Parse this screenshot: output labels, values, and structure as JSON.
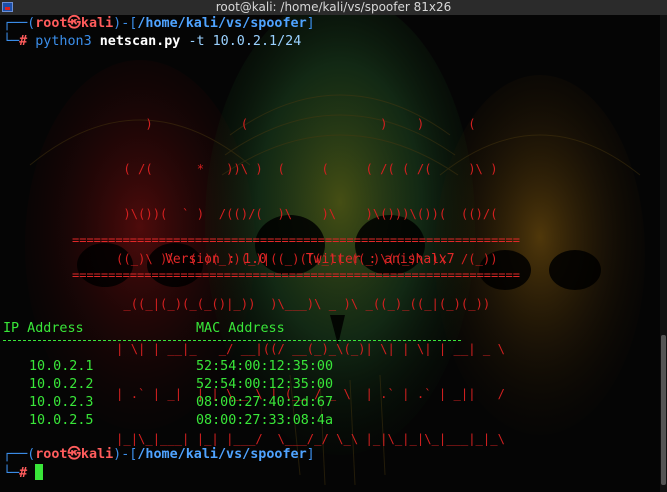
{
  "window": {
    "title": "root@kali: /home/kali/vs/spoofer 81x26"
  },
  "colors": {
    "prompt_blue": "#3b8eea",
    "user_red": "#ff5c5c",
    "banner_red": "#d42020",
    "output_green": "#39e639",
    "background": "#050505"
  },
  "prompt1": {
    "corner_top": "┌──(",
    "user": "root㉿kali",
    "mid": ")-[",
    "path": "/home/kali/vs/spoofer",
    "close": "]",
    "corner_bottom": "└─",
    "hash": "#",
    "command": "python3",
    "script": "netscan.py",
    "args": "-t 10.0.2.1/24"
  },
  "banner": {
    "ascii": [
      "          )            (                  )    )      (     ",
      "       ( /(      *   ))\\ )  (     (     ( /( ( /(     )\\ )  ",
      "       )\\())(  ` )  /(()/(  )\\    )\\    )\\()))\\())(  (()/(  ",
      "      ((_)\\ )\\  ( )(_))(_)|((_)(((_)( ((_)\\((_)\\ )\\  /(_)) ",
      "       _((_|(_)(_(_()|_))  )\\___)\\ _ )\\ _((_)_((_|(_)(_))   ",
      "      | \\| | __|_   _/ __|((/ __(_)_\\(_)| \\| | \\| | __| _ \\  ",
      "      | .` | _|  | | \\__ \\ | (__ / _ \\  | .` | .` | _||   /  ",
      "      |_|\\_|___| |_| |___/  \\___/_/ \\_\\ |_|\\_|_|\\_|___|_|_\\  "
    ],
    "separator": "==============================================================",
    "version_label": "Version :",
    "version_value": "1.0",
    "twitter_label": "Twitter :",
    "twitter_value": "anishalx7"
  },
  "results": {
    "headers": [
      "IP Address",
      "MAC Address"
    ],
    "separator": "-----------------------------------------------------------",
    "rows": [
      {
        "ip": "10.0.2.1",
        "mac": "52:54:00:12:35:00"
      },
      {
        "ip": "10.0.2.2",
        "mac": "52:54:00:12:35:00"
      },
      {
        "ip": "10.0.2.3",
        "mac": "08:00:27:40:2d:67"
      },
      {
        "ip": "10.0.2.5",
        "mac": "08:00:27:33:08:4a"
      }
    ]
  },
  "prompt2": {
    "corner_top": "┌──(",
    "user": "root㉿kali",
    "mid": ")-[",
    "path": "/home/kali/vs/spoofer",
    "close": "]",
    "corner_bottom": "└─",
    "hash": "#"
  }
}
